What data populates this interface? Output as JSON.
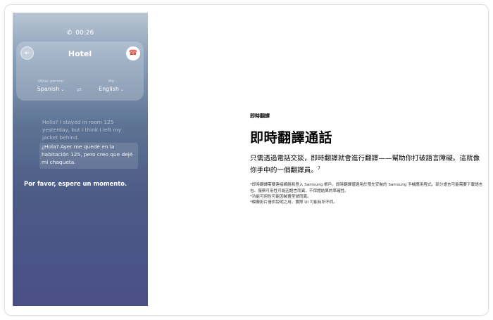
{
  "phone": {
    "status_time": "00:26",
    "call_title": "Hotel",
    "left_lang": {
      "caption": "Other person",
      "language": "Spanish",
      "chevron": "⌄"
    },
    "right_lang": {
      "caption": "Me",
      "language": "English",
      "chevron": "⌄"
    },
    "icons": {
      "status": "phone-icon",
      "exit": "exit-icon",
      "hangup": "hangup-icon",
      "swap": "swap-icon"
    },
    "original_text": "Hello? I stayed in room 125 yesterday, but I think I left my jacket behind.",
    "translated_text": "¿Hola? Ayer me quedé en la habitación 125, pero creo que dejé mi chaqueta.",
    "status_message": "Por favor, espere un momento."
  },
  "feature": {
    "eyebrow": "即時翻譯",
    "title": "即時翻譯通話",
    "description": "只需透過電話交談，即時翻譯就會進行翻譯——幫助你打破語言障礙。這就像你手中的一個翻譯員。",
    "footnote_marker": "7",
    "notes": [
      "*即時翻譯需要連接網絡和登入 Samsung 帳戶。即時翻譯僅適用於預先安裝的 Samsung 手機應用程式。部分語言可能需要下載語言包。服務可用性可能因語言而異，不保證結果的準確性。",
      "*功能可用性可能因裝置型號而異。",
      "*模擬影片僅供說明之用。實際 UI 可能有所不同。"
    ]
  },
  "colors": {
    "hangup": "#e04a3c",
    "phone_bg_top": "#b9c6d4",
    "phone_bg_bottom": "#4a4f86"
  }
}
